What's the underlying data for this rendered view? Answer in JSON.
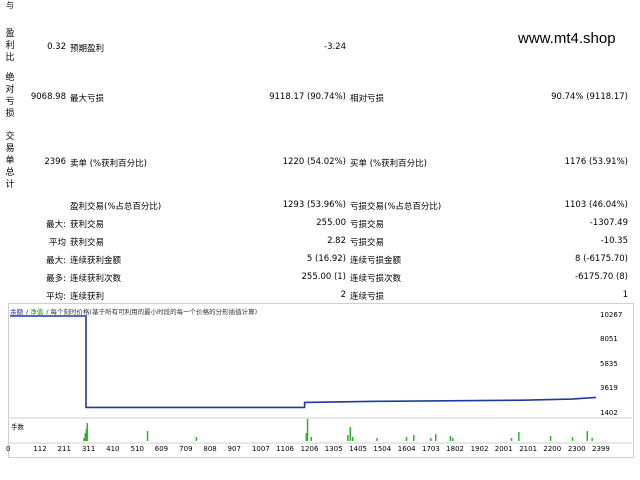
{
  "watermark": "www.mt4.shop",
  "left_labels": {
    "profit_ratio": "盈\n利\n比",
    "absolute_drawdown": "绝\n对\n亏\n损",
    "trade_summary": "交\n易\n单\n总\n计"
  },
  "rows": {
    "r1": {
      "v1": "0.32",
      "l2": "预期盈利",
      "v2": "-3.24"
    },
    "r2": {
      "v1": "9068.98",
      "l2": "最大亏损",
      "v2": "9118.17 (90.74%)",
      "l3": "相对亏损",
      "v3": "90.74% (9118.17)"
    },
    "r3": {
      "v1": "2396",
      "l2": "卖单 (%获利百分比)",
      "v2": "1220 (54.02%)",
      "l3": "买单 (%获利百分比)",
      "v3": "1176 (53.91%)"
    },
    "r4": {
      "l2": "盈利交易(%占总百分比)",
      "v2": "1293 (53.96%)",
      "l3": "亏损交易(%占总百分比)",
      "v3": "1103 (46.04%)"
    },
    "r5": {
      "l1": "最大:",
      "l2": "获利交易",
      "v2": "255.00",
      "l3": "亏损交易",
      "v3": "-1307.49"
    },
    "r6": {
      "l1": "平均",
      "l2": "获利交易",
      "v2": "2.82",
      "l3": "亏损交易",
      "v3": "-10.35"
    },
    "r7": {
      "l1": "最大:",
      "l2": "连续获利金额",
      "v2": "5 (16.92)",
      "l3": "连续亏损金额",
      "v3": "8 (-6175.70)"
    },
    "r8": {
      "l1": "最多:",
      "l2": "连续获利次数",
      "v2": "255.00 (1)",
      "l3": "连续亏损次数",
      "v3": "-6175.70 (8)"
    },
    "r9": {
      "l1": "平均:",
      "l2": "连续获利",
      "v2": "2",
      "l3": "连续亏损",
      "v3": "1"
    }
  },
  "chart_tabs": [
    "余额",
    "净值",
    "每个刻时价格(基于所有可利用的最小时段的每一个价格的分形插值计算)"
  ],
  "volume_label": "手数",
  "chart_data": {
    "type": "line",
    "title": "",
    "series": [
      {
        "color": "#1f3a9e",
        "x": [
          0,
          311,
          311,
          1206,
          1206,
          1500,
          2100,
          2300,
          2399
        ],
        "y": [
          10267,
          10267,
          2000,
          2000,
          2450,
          2550,
          2650,
          2750,
          2900
        ]
      }
    ],
    "y_ticks": [
      "10267",
      "8051",
      "5835",
      "3619",
      "1402"
    ],
    "x_ticks": [
      "0",
      "112",
      "211",
      "311",
      "410",
      "510",
      "609",
      "709",
      "808",
      "907",
      "1007",
      "1106",
      "1206",
      "1305",
      "1405",
      "1504",
      "1604",
      "1703",
      "1802",
      "1902",
      "2001",
      "2101",
      "2200",
      "2300",
      "2399"
    ],
    "ylim": [
      1402,
      10267
    ],
    "xlim": [
      0,
      2399
    ],
    "volume_color": "#2bb52b"
  }
}
